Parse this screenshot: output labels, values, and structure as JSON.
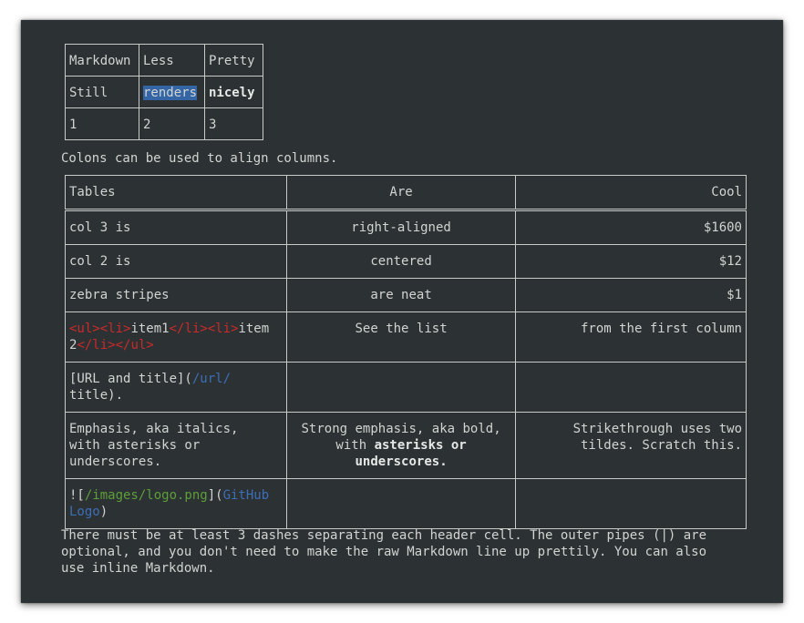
{
  "table1": {
    "rows": [
      [
        "Markdown",
        "Less",
        "Pretty"
      ],
      [
        "Still",
        "renders",
        "nicely"
      ],
      [
        "1",
        "2",
        "3"
      ]
    ]
  },
  "colons_text": "Colons can be used to align columns.",
  "table2": {
    "header": [
      "Tables",
      "Are",
      "Cool"
    ],
    "rows": {
      "r1": [
        "col 3 is",
        "right-aligned",
        "$1600"
      ],
      "r2": [
        "col 2 is",
        "centered",
        "$12"
      ],
      "r3": [
        "zebra stripes",
        "are neat",
        "$1"
      ],
      "r4": {
        "ul_open": "<ul><li>",
        "item1": "item1",
        "li_mid": "</li><li>",
        "item2a": "item",
        "item2b": "2",
        "ul_close": "</li></ul>",
        "col2": "See the list",
        "col3": "from the first column"
      },
      "r5": {
        "text": "[URL and title](",
        "url": "/url/",
        "title": "title)."
      },
      "r6": {
        "col1_line1": "Emphasis, aka italics,",
        "col1_line2": "with asterisks or",
        "col1_line3": "underscores.",
        "col2_line1": "Strong emphasis, aka bold,",
        "col2_line2_pre": "with ",
        "col2_line2_bold": "asterisks or",
        "col2_line3_bold": "underscores.",
        "col3_line1": "Strikethrough uses two",
        "col3_line2": "tildes. Scratch this."
      },
      "r7": {
        "pre": "![",
        "path": "/images/logo.png",
        "mid": "](",
        "alt1": "GitHub",
        "alt2": "Logo",
        "close": ")"
      }
    }
  },
  "footer_lines": [
    "There must be at least 3 dashes separating each header cell. The outer pipes (|) are",
    "optional, and you don't need to make the raw Markdown line up prettily. You can also",
    "use inline Markdown."
  ],
  "colors": {
    "background": "#2c3133",
    "text": "#d2d4d2",
    "highlight": "#3465a4",
    "tag_red": "#cc2a2a",
    "link_blue": "#3d6fb6",
    "path_green": "#5e9f3a"
  }
}
